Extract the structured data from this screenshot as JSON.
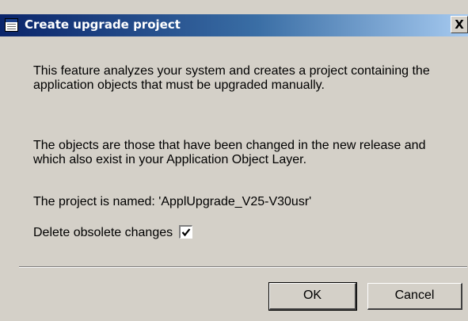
{
  "window": {
    "title": "Create upgrade project",
    "close_glyph": "X",
    "icon": "form-window-icon"
  },
  "body": {
    "paragraph1": "This feature analyzes your system and creates a project containing the application objects that must be upgraded manually.",
    "paragraph2": "The objects are those that have been changed in the new release and which also exist in your Application Object Layer.",
    "project_name_line": "The project is named: 'ApplUpgrade_V25-V30usr'"
  },
  "options": {
    "delete_obsolete_label": "Delete obsolete changes",
    "delete_obsolete_checked": true
  },
  "buttons": {
    "ok_label": "OK",
    "cancel_label": "Cancel"
  },
  "colors": {
    "titlebar_start": "#0a246a",
    "titlebar_end": "#a6caf0",
    "dialog_face": "#d4d0c8"
  }
}
